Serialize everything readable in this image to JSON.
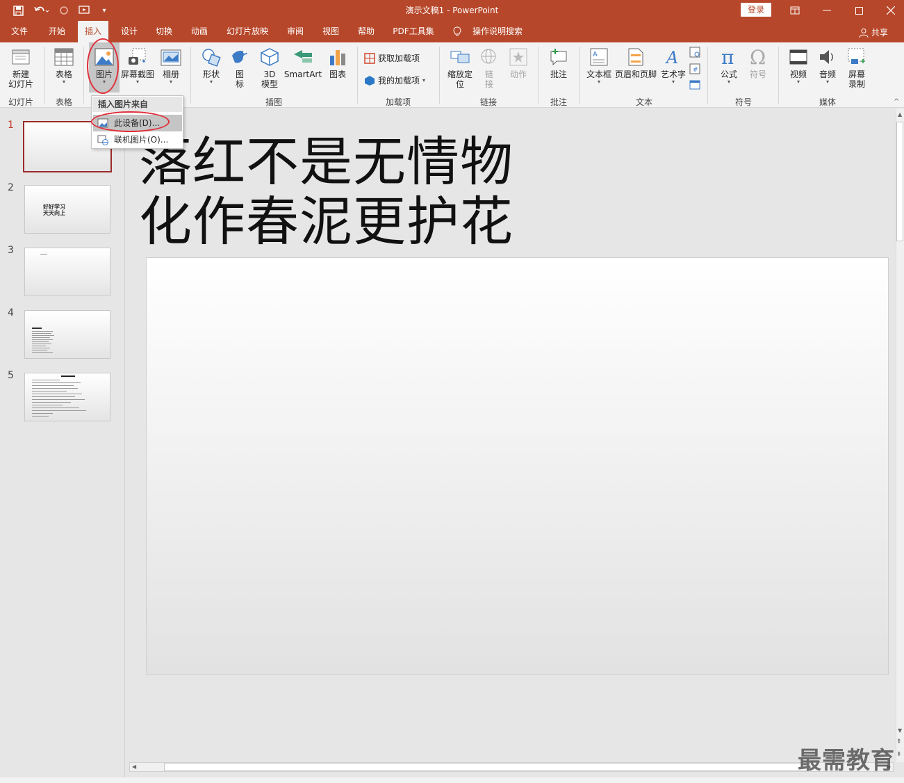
{
  "window": {
    "title": "演示文稿1  -  PowerPoint",
    "login_label": "登录",
    "share_label": "共享"
  },
  "tabs": [
    {
      "label": "文件"
    },
    {
      "label": "开始"
    },
    {
      "label": "插入"
    },
    {
      "label": "设计"
    },
    {
      "label": "切换"
    },
    {
      "label": "动画"
    },
    {
      "label": "幻灯片放映"
    },
    {
      "label": "审阅"
    },
    {
      "label": "视图"
    },
    {
      "label": "帮助"
    },
    {
      "label": "PDF工具集"
    },
    {
      "label": "操作说明搜索"
    }
  ],
  "active_tab": "插入",
  "ribbon": {
    "new_slide": "新建\n幻灯片",
    "table": "表格",
    "picture": "图片",
    "screenshot": "屏幕截图",
    "album": "相册",
    "shapes": "形状",
    "icons": "图\n标",
    "model3d": "3D\n模型",
    "smartart": "SmartArt",
    "chart": "图表",
    "get_addins": "获取加载项",
    "my_addins": "我的加载项",
    "zoom": "缩放定\n位",
    "link": "链\n接",
    "action": "动作",
    "comment": "批注",
    "textbox": "文本框",
    "header_footer": "页眉和页脚",
    "wordart": "艺术字",
    "equation": "公式",
    "symbol": "符号",
    "video": "视频",
    "audio": "音频",
    "screen_rec": "屏幕\n录制",
    "groups": {
      "slides": "幻灯片",
      "tables": "表格",
      "illustrations": "插图",
      "addins": "加载项",
      "links": "链接",
      "comments": "批注",
      "text": "文本",
      "symbols": "符号",
      "media": "媒体"
    }
  },
  "dropdown": {
    "header": "插入图片来自",
    "items": [
      {
        "label": "此设备(D)...",
        "highlighted": true
      },
      {
        "label": "联机图片(O)..."
      }
    ]
  },
  "thumbnails": [
    {
      "num": "1",
      "text": ""
    },
    {
      "num": "2",
      "text": "好好学习\n天天向上"
    },
    {
      "num": "3",
      "text": ""
    },
    {
      "num": "4",
      "text": ""
    },
    {
      "num": "5",
      "text": ""
    }
  ],
  "slide": {
    "title_line1": "落红不是无情物",
    "title_line2": "化作春泥更护花"
  },
  "watermark": "最需教育",
  "colors": {
    "accent": "#b7472a",
    "annotation": "#e0303a"
  }
}
